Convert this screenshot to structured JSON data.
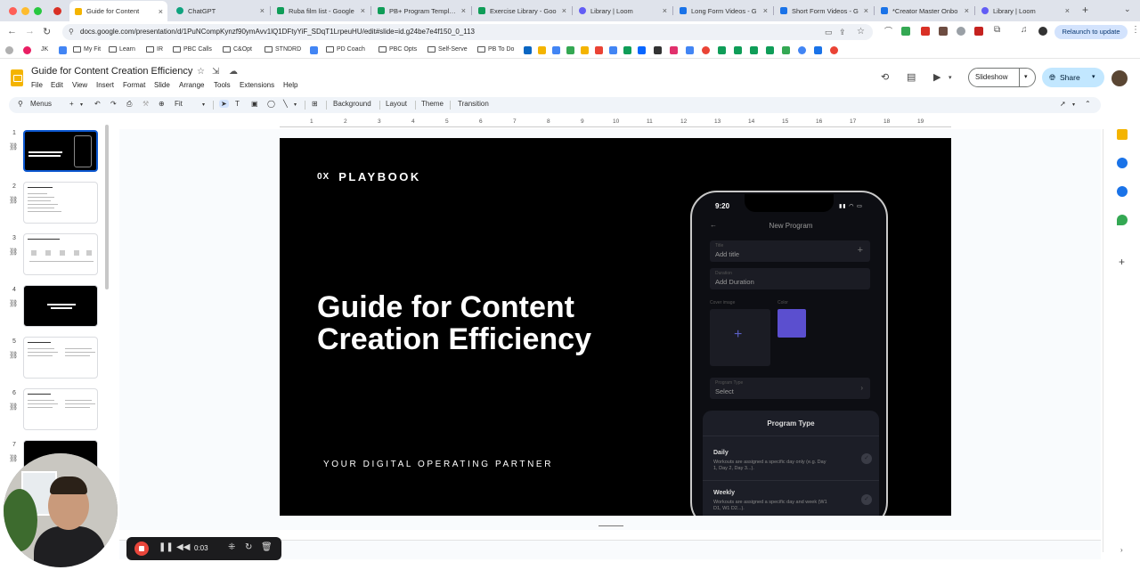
{
  "browser": {
    "tabs": [
      {
        "title": "Guide for Content",
        "active": true,
        "color": "#f4b400"
      },
      {
        "title": "ChatGPT",
        "active": false,
        "color": "#10a37f"
      },
      {
        "title": "Ruba film list - Google",
        "active": false,
        "color": "#0f9d58"
      },
      {
        "title": "PB+ Program Template",
        "active": false,
        "color": "#0f9d58"
      },
      {
        "title": "Exercise Library - Goo",
        "active": false,
        "color": "#0f9d58"
      },
      {
        "title": "Library | Loom",
        "active": false,
        "color": "#625df5"
      },
      {
        "title": "Long Form Videos - G",
        "active": false,
        "color": "#1a73e8"
      },
      {
        "title": "Short Form Videos - G",
        "active": false,
        "color": "#1a73e8"
      },
      {
        "title": "*Creator Master Onbo",
        "active": false,
        "color": "#1a73e8"
      },
      {
        "title": "Library | Loom",
        "active": false,
        "color": "#625df5"
      }
    ],
    "new_tab": "+",
    "url": "docs.google.com/presentation/d/1PuNCompKynzf90ymAvv1lQ1DFtyYiF_SDqT1LrpeuHU/edit#slide=id.g24be7e4f150_0_113",
    "relaunch_label": "Relaunch to update",
    "bookmarks": [
      {
        "label": "JK",
        "folder": false
      },
      {
        "label": "My Fit",
        "folder": false
      },
      {
        "label": "Learn",
        "folder": false
      },
      {
        "label": "IR",
        "folder": true
      },
      {
        "label": "PBC Calls",
        "folder": true
      },
      {
        "label": "C&Opt",
        "folder": true
      },
      {
        "label": "STNDRD",
        "folder": true
      },
      {
        "label": "PD Coach",
        "folder": true
      },
      {
        "label": "PBC Opts",
        "folder": true
      },
      {
        "label": "Self-Serve",
        "folder": true
      },
      {
        "label": "PB To Do",
        "folder": true
      }
    ]
  },
  "app": {
    "title": "Guide for Content Creation Efficiency",
    "menus": [
      "File",
      "Edit",
      "View",
      "Insert",
      "Format",
      "Slide",
      "Arrange",
      "Tools",
      "Extensions",
      "Help"
    ],
    "slideshow_label": "Slideshow",
    "share_label": "Share",
    "toolbar": {
      "menus_label": "Menus",
      "zoom_label": "Fit",
      "background_label": "Background",
      "layout_label": "Layout",
      "theme_label": "Theme",
      "transition_label": "Transition"
    },
    "ruler_ticks": [
      "1",
      "2",
      "3",
      "4",
      "5",
      "6",
      "7",
      "8",
      "9",
      "10",
      "11",
      "12",
      "13",
      "14",
      "15",
      "16",
      "17",
      "18",
      "19"
    ]
  },
  "filmstrip": {
    "slides": [
      {
        "num": "1",
        "selected": true,
        "dark": true
      },
      {
        "num": "2",
        "selected": false,
        "dark": false
      },
      {
        "num": "3",
        "selected": false,
        "dark": false
      },
      {
        "num": "4",
        "selected": false,
        "dark": true
      },
      {
        "num": "5",
        "selected": false,
        "dark": false
      },
      {
        "num": "6",
        "selected": false,
        "dark": false
      },
      {
        "num": "7",
        "selected": false,
        "dark": true
      }
    ]
  },
  "slide": {
    "logo_mark": "0X",
    "logo_text": "PLAYBOOK",
    "title_line1": "Guide for Content",
    "title_line2": "Creation Efficiency",
    "subtitle": "YOUR DIGITAL OPERATING PARTNER",
    "phone": {
      "time": "9:20",
      "header": "New Program",
      "title_label": "Title",
      "title_value": "Add title",
      "duration_label": "Duration",
      "duration_value": "Add Duration",
      "cover_label": "Cover image",
      "color_label": "Color",
      "type_label": "Program Type",
      "type_value": "Select",
      "sheet_title": "Program Type",
      "options": [
        {
          "title": "Daily",
          "desc": "Workouts are assigned a specific day only (e.g. Day 1, Day 2, Day 3...)."
        },
        {
          "title": "Weekly",
          "desc": "Workouts are assigned a specific day and week (W1 D1, W1 D2...)."
        }
      ]
    }
  },
  "recorder": {
    "time": "0:03"
  }
}
